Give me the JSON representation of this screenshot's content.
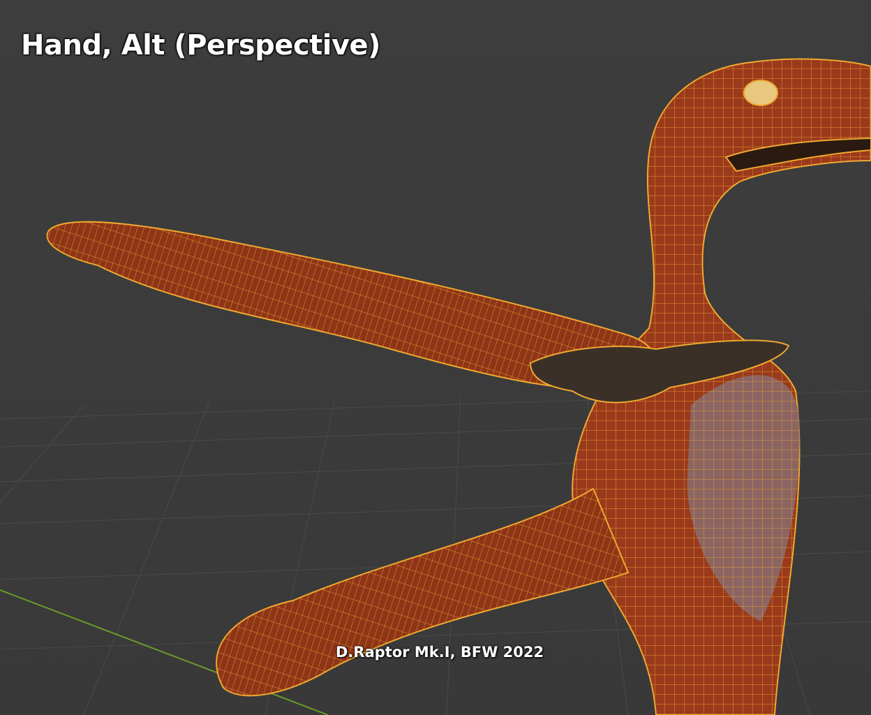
{
  "viewport": {
    "view_label": "Hand, Alt (Perspective)",
    "credit": "D.Raptor Mk.I, BFW 2022",
    "colors": {
      "background": "#3b3b3b",
      "mesh_fill": "#9a3a1c",
      "wireframe": "#f0a830",
      "belly": "#8a6a6a",
      "x_axis": "#6a9a2a"
    }
  }
}
